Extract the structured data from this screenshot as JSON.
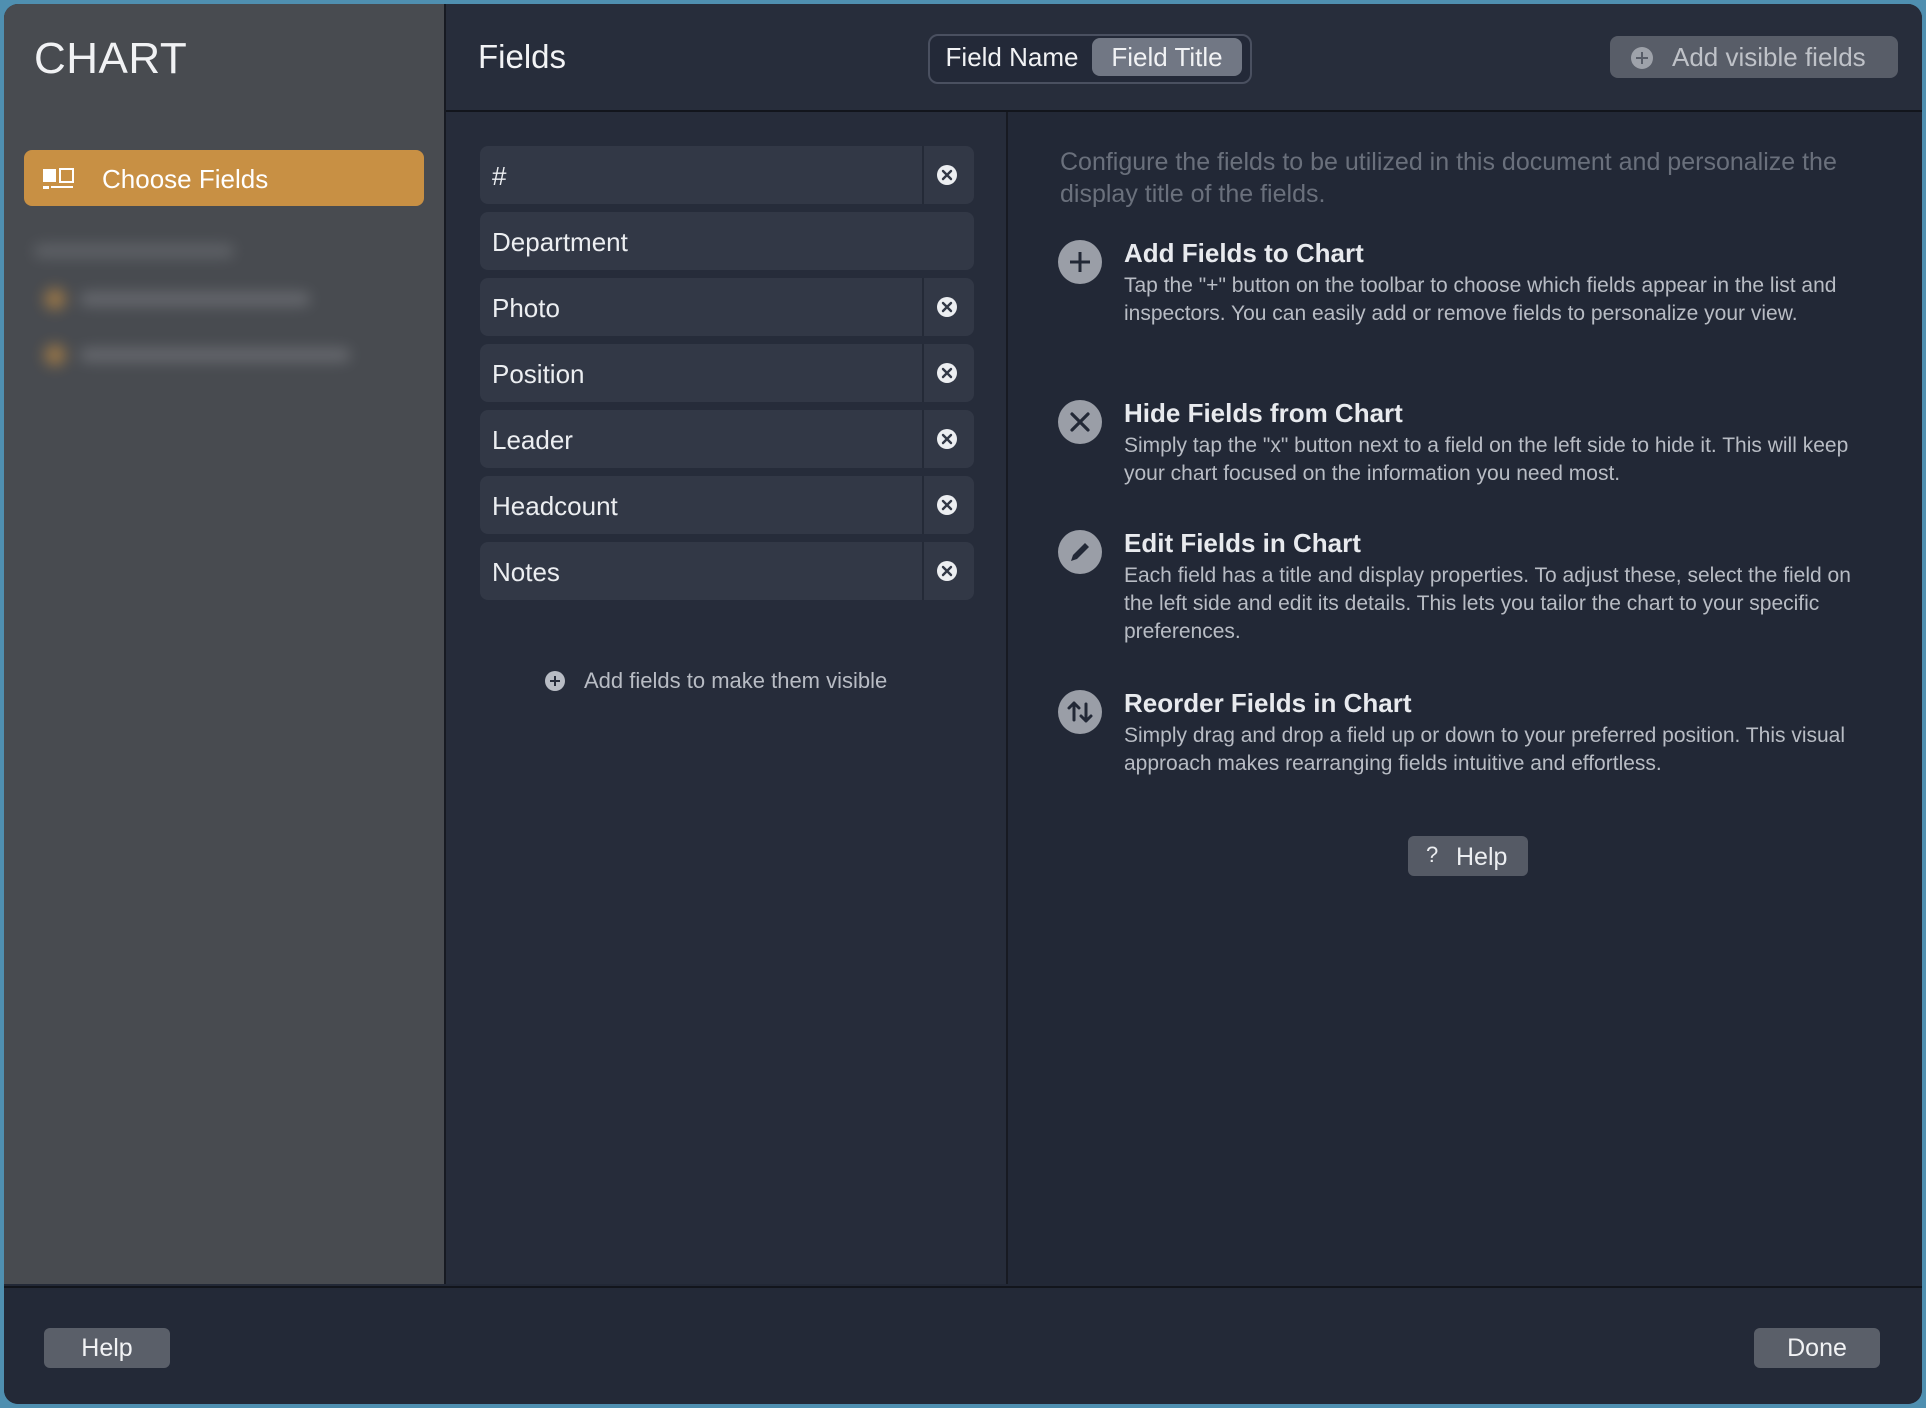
{
  "sidebar": {
    "app_title": "CHART",
    "items": [
      {
        "label": "Choose Fields",
        "icon": "choose-fields-icon",
        "selected": true
      }
    ]
  },
  "header": {
    "title": "Fields",
    "segment": {
      "options": [
        "Field Name",
        "Field Title"
      ],
      "selected": "Field Title"
    },
    "add_visible_label": "Add visible fields"
  },
  "fields": [
    {
      "label": "#",
      "removable": true
    },
    {
      "label": "Department",
      "removable": false
    },
    {
      "label": "Photo",
      "removable": true
    },
    {
      "label": "Position",
      "removable": true
    },
    {
      "label": "Leader",
      "removable": true
    },
    {
      "label": "Headcount",
      "removable": true
    },
    {
      "label": "Notes",
      "removable": true
    }
  ],
  "add_fields_label": "Add fields to make them visible",
  "content": {
    "intro": "Configure the fields to be utilized in this document and personalize the display title of the fields.",
    "topics": [
      {
        "icon": "plus-icon",
        "title": "Add Fields to Chart",
        "text": "Tap the \"+\" button on the toolbar to choose which fields appear in the list and inspectors. You can easily add or remove fields to personalize your view."
      },
      {
        "icon": "close-icon",
        "title": "Hide Fields from Chart",
        "text": "Simply tap the \"x\" button next to a field on the left side to hide it. This will keep your chart focused on the information you need most."
      },
      {
        "icon": "pencil-icon",
        "title": "Edit Fields in Chart",
        "text": "Each field has a title and display properties. To adjust these, select the field on the left side and edit its details. This lets you tailor the chart to your specific preferences."
      },
      {
        "icon": "reorder-icon",
        "title": "Reorder Fields in Chart",
        "text": "Simply drag and drop a field up or down to your preferred position. This visual approach makes rearranging fields intuitive and effortless."
      }
    ],
    "help_button": {
      "symbol": "?",
      "label": "Help"
    }
  },
  "footer": {
    "help_label": "Help",
    "done_label": "Done"
  },
  "colors": {
    "accent": "#c89044",
    "background": "#222836",
    "sidebar": "#484b50"
  }
}
